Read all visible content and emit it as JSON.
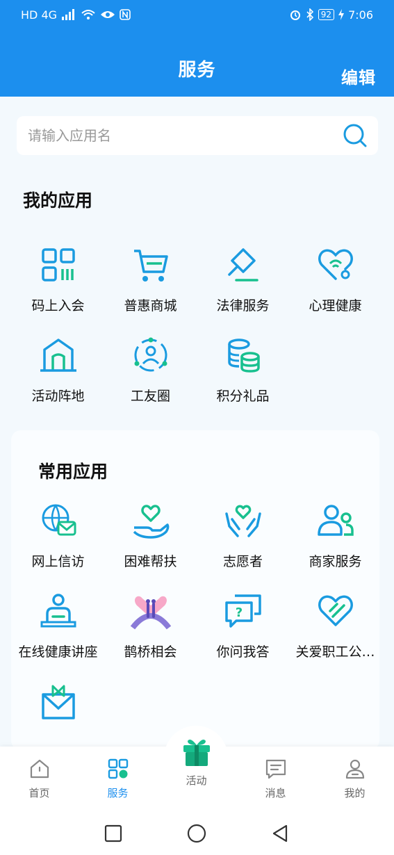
{
  "status_bar": {
    "left_text": "HD 4G",
    "battery": "92",
    "time": "7:06"
  },
  "header": {
    "title": "服务",
    "edit_label": "编辑"
  },
  "search": {
    "placeholder": "请输入应用名",
    "icon": "search-icon"
  },
  "my_apps": {
    "title": "我的应用",
    "items": [
      {
        "label": "码上入会",
        "icon": "qr-code-icon"
      },
      {
        "label": "普惠商城",
        "icon": "shopping-cart-icon"
      },
      {
        "label": "法律服务",
        "icon": "gavel-icon"
      },
      {
        "label": "心理健康",
        "icon": "heart-stethoscope-icon"
      },
      {
        "label": "活动阵地",
        "icon": "building-icon"
      },
      {
        "label": "工友圈",
        "icon": "community-circle-icon"
      },
      {
        "label": "积分礼品",
        "icon": "coin-stack-icon"
      }
    ]
  },
  "common_apps": {
    "title": "常用应用",
    "items": [
      {
        "label": "网上信访",
        "icon": "globe-mail-icon"
      },
      {
        "label": "困难帮扶",
        "icon": "hand-heart-icon"
      },
      {
        "label": "志愿者",
        "icon": "hands-heart-icon"
      },
      {
        "label": "商家服务",
        "icon": "merchant-people-icon"
      },
      {
        "label": "在线健康讲座",
        "icon": "online-lecture-icon"
      },
      {
        "label": "鹊桥相会",
        "icon": "magpie-bridge-icon"
      },
      {
        "label": "你问我答",
        "icon": "qa-chat-icon"
      },
      {
        "label": "关爱职工公…",
        "icon": "care-heart-icon"
      },
      {
        "label": "",
        "icon": "gift-box-icon"
      }
    ]
  },
  "tabbar": {
    "items": [
      {
        "label": "首页",
        "icon": "home-icon",
        "active": false
      },
      {
        "label": "服务",
        "icon": "grid-apps-icon",
        "active": true
      },
      {
        "label": "活动",
        "icon": "gift-icon",
        "active": false
      },
      {
        "label": "消息",
        "icon": "message-icon",
        "active": false
      },
      {
        "label": "我的",
        "icon": "user-icon",
        "active": false
      }
    ]
  },
  "colors": {
    "primary": "#1c8fee",
    "icon_blue": "#1a9be0",
    "icon_green": "#18c08f",
    "background": "#f3f9fd"
  }
}
